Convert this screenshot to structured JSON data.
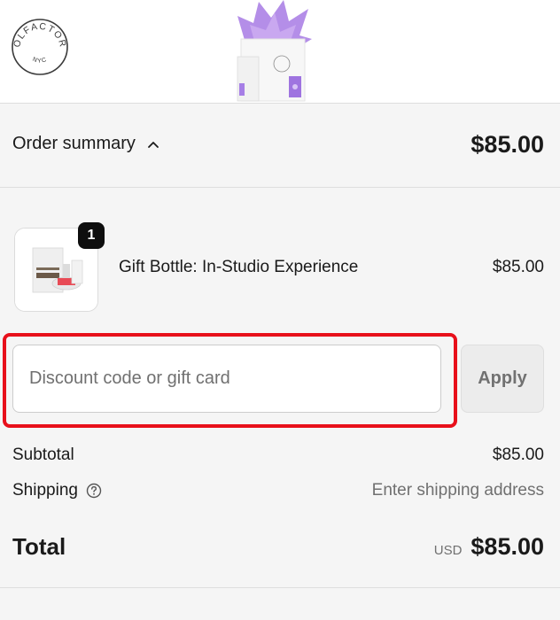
{
  "brand": {
    "logo_text": "OLFACTORY",
    "logo_subtext": "NYC"
  },
  "summary": {
    "toggle_label": "Order summary",
    "total": "$85.00"
  },
  "line_item": {
    "quantity": "1",
    "name": "Gift Bottle: In-Studio Experience",
    "price": "$85.00"
  },
  "discount": {
    "placeholder": "Discount code or gift card",
    "apply_label": "Apply"
  },
  "totals": {
    "subtotal_label": "Subtotal",
    "subtotal_value": "$85.00",
    "shipping_label": "Shipping",
    "shipping_value": "Enter shipping address",
    "total_label": "Total",
    "currency": "USD",
    "total_value": "$85.00"
  },
  "colors": {
    "highlight": "#e8101b",
    "panel_bg": "#f5f5f5",
    "tissue": "#b48ee8"
  }
}
